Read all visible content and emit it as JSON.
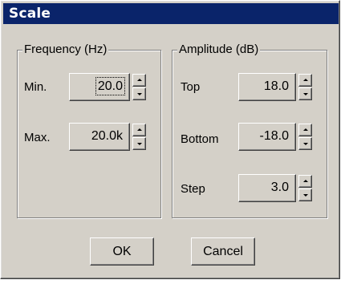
{
  "window": {
    "title": "Scale"
  },
  "frequency": {
    "legend": "Frequency (Hz)",
    "min": {
      "label": "Min.",
      "value": "20.0"
    },
    "max": {
      "label": "Max.",
      "value": "20.0k"
    }
  },
  "amplitude": {
    "legend": "Amplitude (dB)",
    "top": {
      "label": "Top",
      "value": "18.0"
    },
    "bottom": {
      "label": "Bottom",
      "value": "-18.0"
    },
    "step": {
      "label": "Step",
      "value": "3.0"
    }
  },
  "buttons": {
    "ok": "OK",
    "cancel": "Cancel"
  }
}
